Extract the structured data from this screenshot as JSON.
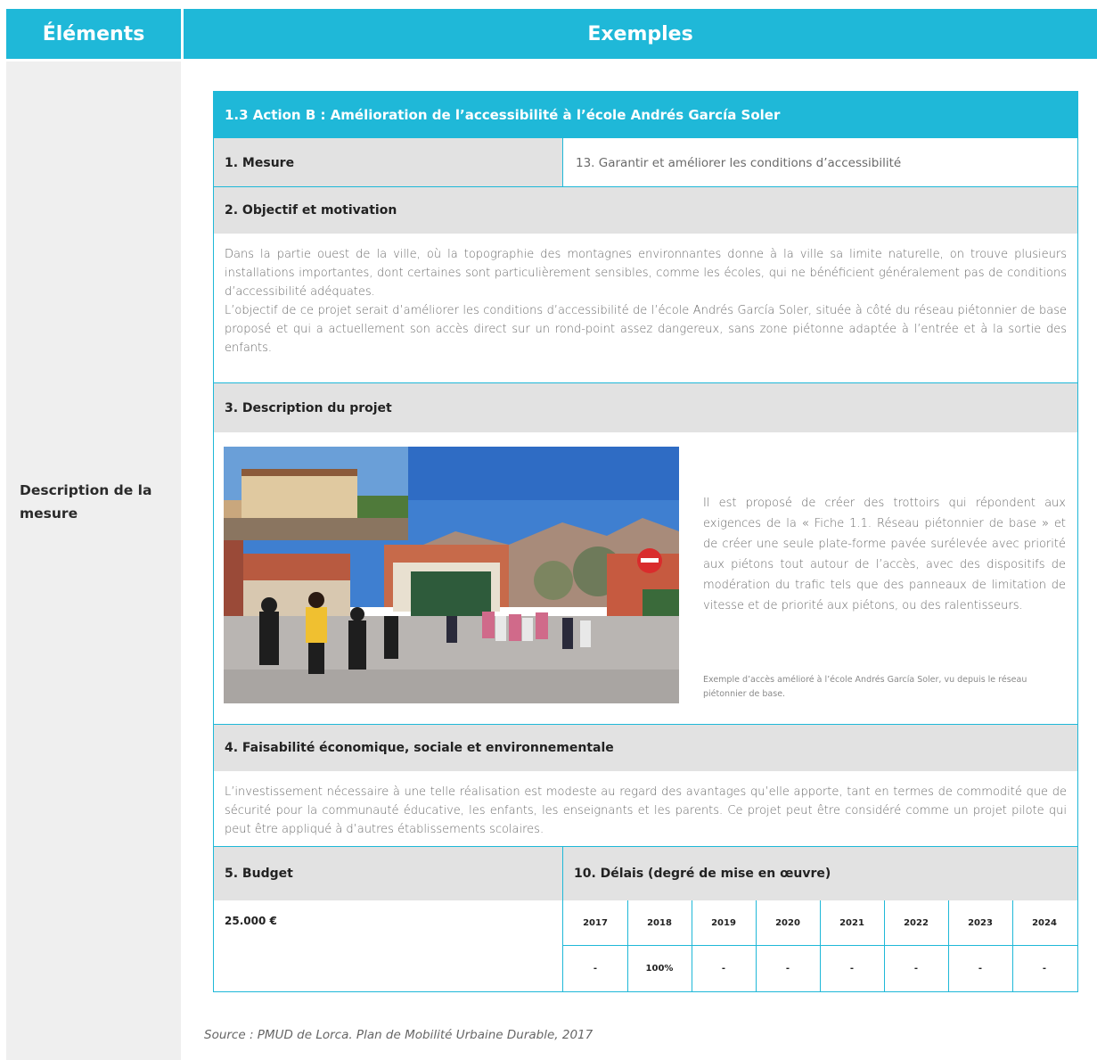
{
  "header": {
    "elements": "Éléments",
    "examples": "Exemples"
  },
  "left_label": "Description de la mesure",
  "card": {
    "title": "1.3 Action B : Amélioration de l’accessibilité à l’école Andrés García Soler",
    "mesure_label": "1. Mesure",
    "mesure_value": "13. Garantir et améliorer les conditions d’accessibilité",
    "objectif_label": "2. Objectif et motivation",
    "objectif_p1": "Dans la partie ouest de la ville, où la topographie des montagnes environnantes donne à la ville sa limite naturelle, on trouve plusieurs installations importantes, dont certaines sont particulièrement sensibles, comme les écoles, qui ne bénéficient généralement pas de conditions d’accessibilité adéquates.",
    "objectif_p2": "L’objectif de ce projet serait d’améliorer les conditions d’accessibilité de l’école Andrés García Soler, située à côté du réseau piétonnier de base proposé et qui a actuellement son accès direct sur un rond-point assez dangereux, sans zone piétonne adaptée à l’entrée et à la sortie des enfants.",
    "description_label": "3. Description du projet",
    "description_text": "Il est proposé de créer des trottoirs qui répondent aux exigences de la « Fiche 1.1. Réseau piétonnier de base » et de créer une seule plate-forme pavée surélevée avec priorité aux piétons tout autour de l’accès, avec des dispositifs de modération du trafic tels que des panneaux de limitation de vitesse et de priorité aux piétons, ou des ralentisseurs.",
    "photo_caption": "Exemple d’accès amélioré à l’école Andrés García Soler, vu depuis le réseau piétonnier de base.",
    "faisabilite_label": "4. Faisabilité économique, sociale et environnementale",
    "faisabilite_text": "L’investissement nécessaire à une telle réalisation est modeste au regard des avantages qu’elle apporte, tant en termes de commodité que de sécurité pour la communauté éducative, les enfants, les enseignants et les parents. Ce projet peut être considéré comme un projet pilote qui peut être appliqué à d’autres établissements scolaires.",
    "budget_label": "5. Budget",
    "budget_value": "25.000 €",
    "delais_label": "10. Délais (degré de mise en œuvre)",
    "years": [
      "2017",
      "2018",
      "2019",
      "2020",
      "2021",
      "2022",
      "2023",
      "2024"
    ],
    "year_values": [
      "-",
      "100%",
      "-",
      "-",
      "-",
      "-",
      "-",
      "-"
    ]
  },
  "source": "Source : PMUD de Lorca. Plan de Mobilité Urbaine Durable, 2017"
}
